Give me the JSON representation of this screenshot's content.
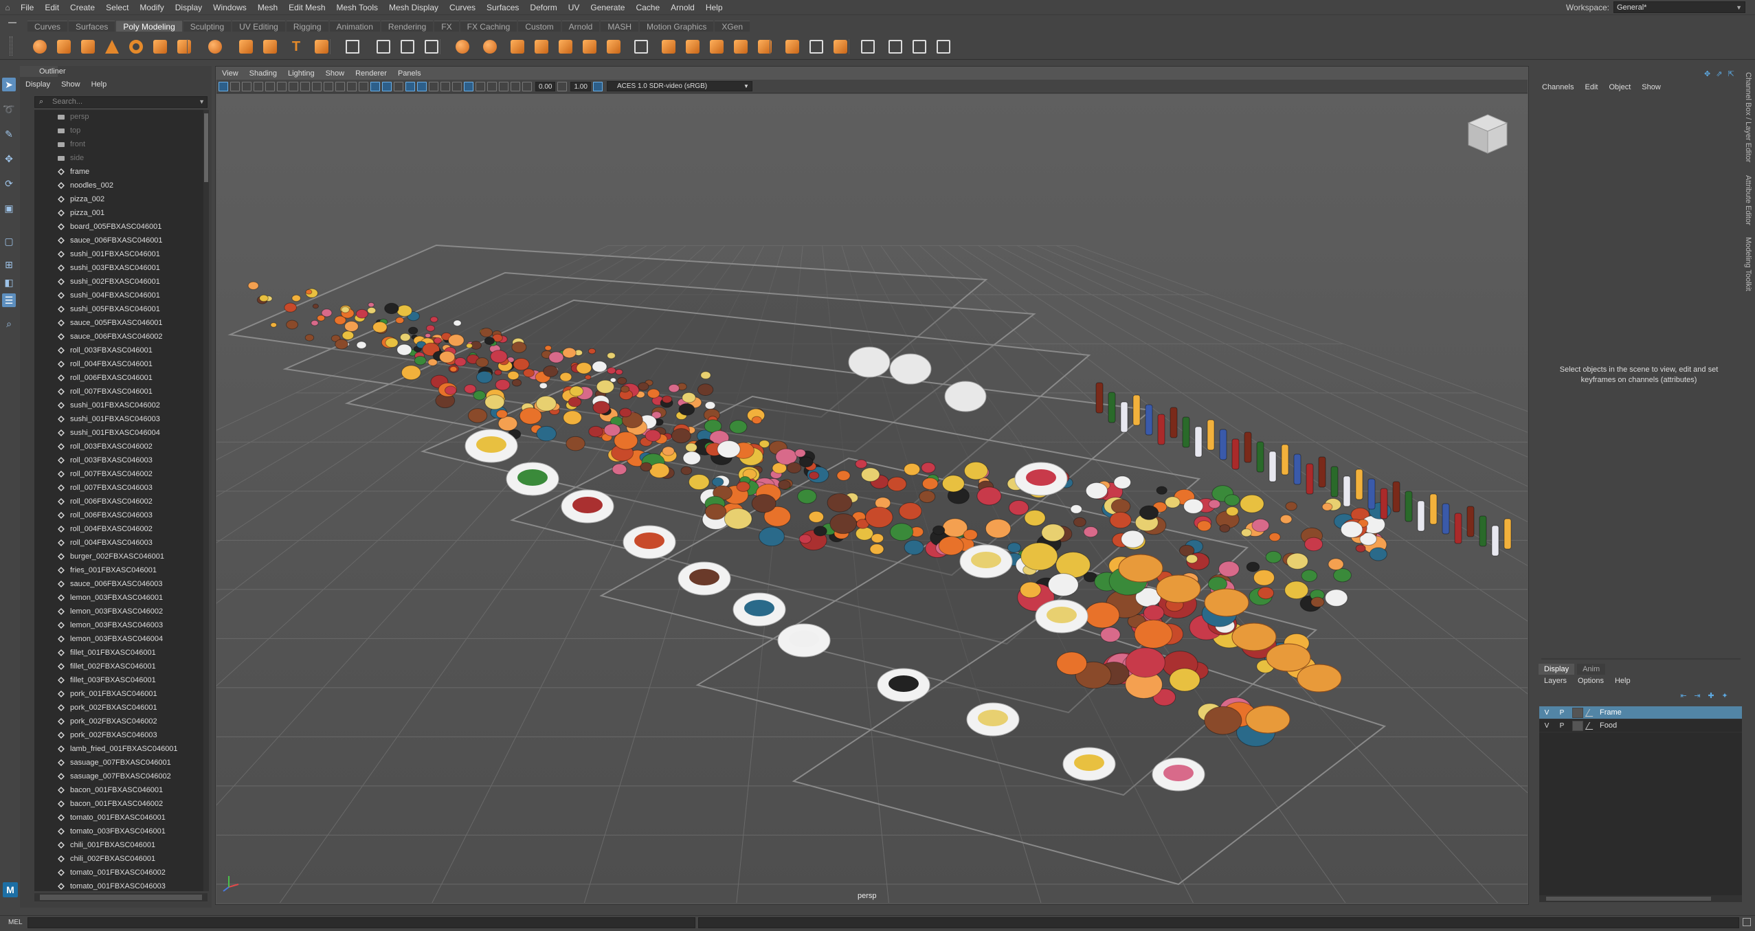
{
  "menubar": {
    "items": [
      "File",
      "Edit",
      "Create",
      "Select",
      "Modify",
      "Display",
      "Windows",
      "Mesh",
      "Edit Mesh",
      "Mesh Tools",
      "Mesh Display",
      "Curves",
      "Surfaces",
      "Deform",
      "UV",
      "Generate",
      "Cache",
      "Arnold",
      "Help"
    ],
    "workspace_label": "Workspace:",
    "workspace_value": "General*"
  },
  "shelf_tabs": {
    "items": [
      "Curves",
      "Surfaces",
      "Poly Modeling",
      "Sculpting",
      "UV Editing",
      "Rigging",
      "Animation",
      "Rendering",
      "FX",
      "FX Caching",
      "Custom",
      "Arnold",
      "MASH",
      "Motion Graphics",
      "XGen"
    ],
    "active": "Poly Modeling"
  },
  "outliner": {
    "tab_label": "Outliner",
    "menu": [
      "Display",
      "Show",
      "Help"
    ],
    "search_placeholder": "Search...",
    "rows": [
      {
        "label": "persp",
        "kind": "cam",
        "dim": true
      },
      {
        "label": "top",
        "kind": "cam",
        "dim": true
      },
      {
        "label": "front",
        "kind": "cam",
        "dim": true
      },
      {
        "label": "side",
        "kind": "cam",
        "dim": true
      },
      {
        "label": "frame",
        "kind": "xform"
      },
      {
        "label": "noodles_002",
        "kind": "xform"
      },
      {
        "label": "pizza_002",
        "kind": "xform"
      },
      {
        "label": "pizza_001",
        "kind": "xform"
      },
      {
        "label": "board_005FBXASC046001",
        "kind": "xform"
      },
      {
        "label": "sauce_006FBXASC046001",
        "kind": "xform"
      },
      {
        "label": "sushi_001FBXASC046001",
        "kind": "xform"
      },
      {
        "label": "sushi_003FBXASC046001",
        "kind": "xform"
      },
      {
        "label": "sushi_002FBXASC046001",
        "kind": "xform"
      },
      {
        "label": "sushi_004FBXASC046001",
        "kind": "xform"
      },
      {
        "label": "sushi_005FBXASC046001",
        "kind": "xform"
      },
      {
        "label": "sauce_005FBXASC046001",
        "kind": "xform"
      },
      {
        "label": "sauce_006FBXASC046002",
        "kind": "xform"
      },
      {
        "label": "roll_003FBXASC046001",
        "kind": "xform"
      },
      {
        "label": "roll_004FBXASC046001",
        "kind": "xform"
      },
      {
        "label": "roll_006FBXASC046001",
        "kind": "xform"
      },
      {
        "label": "roll_007FBXASC046001",
        "kind": "xform"
      },
      {
        "label": "sushi_001FBXASC046002",
        "kind": "xform"
      },
      {
        "label": "sushi_001FBXASC046003",
        "kind": "xform"
      },
      {
        "label": "sushi_001FBXASC046004",
        "kind": "xform"
      },
      {
        "label": "roll_003FBXASC046002",
        "kind": "xform"
      },
      {
        "label": "roll_003FBXASC046003",
        "kind": "xform"
      },
      {
        "label": "roll_007FBXASC046002",
        "kind": "xform"
      },
      {
        "label": "roll_007FBXASC046003",
        "kind": "xform"
      },
      {
        "label": "roll_006FBXASC046002",
        "kind": "xform"
      },
      {
        "label": "roll_006FBXASC046003",
        "kind": "xform"
      },
      {
        "label": "roll_004FBXASC046002",
        "kind": "xform"
      },
      {
        "label": "roll_004FBXASC046003",
        "kind": "xform"
      },
      {
        "label": "burger_002FBXASC046001",
        "kind": "xform"
      },
      {
        "label": "fries_001FBXASC046001",
        "kind": "xform"
      },
      {
        "label": "sauce_006FBXASC046003",
        "kind": "xform"
      },
      {
        "label": "lemon_003FBXASC046001",
        "kind": "xform"
      },
      {
        "label": "lemon_003FBXASC046002",
        "kind": "xform"
      },
      {
        "label": "lemon_003FBXASC046003",
        "kind": "xform"
      },
      {
        "label": "lemon_003FBXASC046004",
        "kind": "xform"
      },
      {
        "label": "fillet_001FBXASC046001",
        "kind": "xform"
      },
      {
        "label": "fillet_002FBXASC046001",
        "kind": "xform"
      },
      {
        "label": "fillet_003FBXASC046001",
        "kind": "xform"
      },
      {
        "label": "pork_001FBXASC046001",
        "kind": "xform"
      },
      {
        "label": "pork_002FBXASC046001",
        "kind": "xform"
      },
      {
        "label": "pork_002FBXASC046002",
        "kind": "xform"
      },
      {
        "label": "pork_002FBXASC046003",
        "kind": "xform"
      },
      {
        "label": "lamb_fried_001FBXASC046001",
        "kind": "xform"
      },
      {
        "label": "sasuage_007FBXASC046001",
        "kind": "xform"
      },
      {
        "label": "sasuage_007FBXASC046002",
        "kind": "xform"
      },
      {
        "label": "bacon_001FBXASC046001",
        "kind": "xform"
      },
      {
        "label": "bacon_001FBXASC046002",
        "kind": "xform"
      },
      {
        "label": "tomato_001FBXASC046001",
        "kind": "xform"
      },
      {
        "label": "tomato_003FBXASC046001",
        "kind": "xform"
      },
      {
        "label": "chili_001FBXASC046001",
        "kind": "xform"
      },
      {
        "label": "chili_002FBXASC046001",
        "kind": "xform"
      },
      {
        "label": "tomato_001FBXASC046002",
        "kind": "xform"
      },
      {
        "label": "tomato_001FBXASC046003",
        "kind": "xform"
      }
    ]
  },
  "viewport": {
    "menu": [
      "View",
      "Shading",
      "Lighting",
      "Show",
      "Renderer",
      "Panels"
    ],
    "exposure": "0.00",
    "gamma": "1.00",
    "color_space": "ACES 1.0 SDR-video (sRGB)",
    "camera_label": "persp"
  },
  "channel_box": {
    "menu": [
      "Channels",
      "Edit",
      "Object",
      "Show"
    ],
    "message": "Select objects in the scene to view, edit and set keyframes on channels (attributes)",
    "side_tabs": [
      "Channel Box / Layer Editor",
      "Attribute Editor",
      "Modeling Toolkit"
    ]
  },
  "layer_editor": {
    "tabs": [
      "Display",
      "Anim"
    ],
    "active_tab": "Display",
    "menu": [
      "Layers",
      "Options",
      "Help"
    ],
    "layers": [
      {
        "v": "V",
        "p": "P",
        "name": "Frame",
        "selected": true
      },
      {
        "v": "V",
        "p": "P",
        "name": "Food",
        "selected": false
      }
    ]
  },
  "command_line": {
    "language": "MEL"
  },
  "colors": {
    "accent_orange": "#e58a2a",
    "selection_blue": "#5285a6",
    "maya_blue": "#1d6fa5"
  }
}
